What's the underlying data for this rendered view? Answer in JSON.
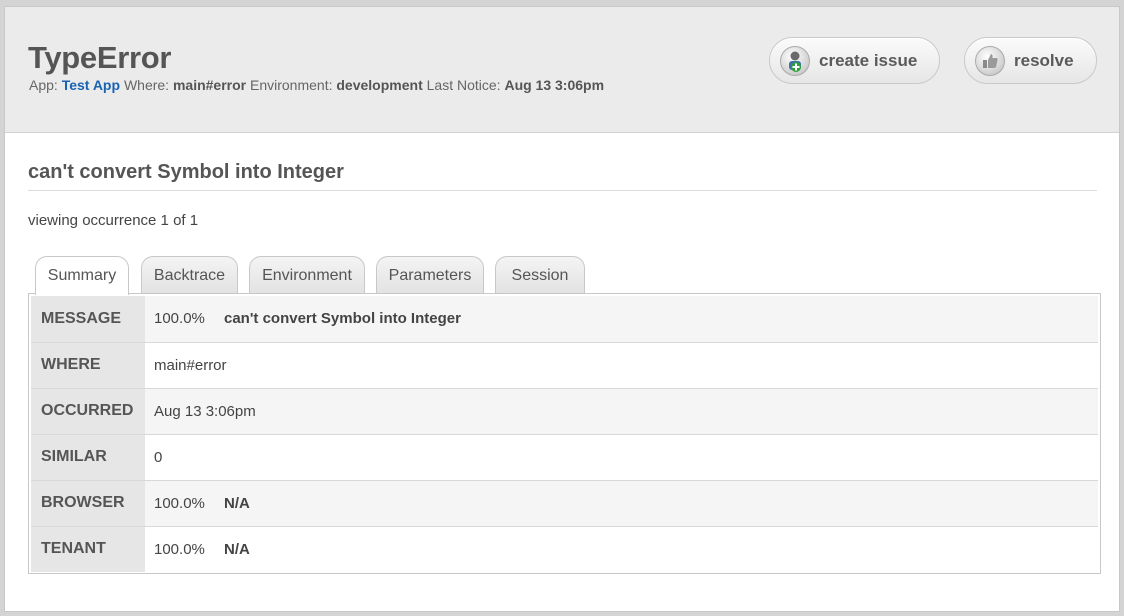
{
  "header": {
    "title": "TypeError",
    "app_label": "App:",
    "app_value": "Test App",
    "where_label": "Where:",
    "where_value": "main#error",
    "env_label": "Environment:",
    "env_value": "development",
    "last_notice_label": "Last Notice:",
    "last_notice_value": "Aug 13 3:06pm",
    "create_issue_label": "create issue",
    "resolve_label": "resolve"
  },
  "main": {
    "error_message": "can't convert Symbol into Integer",
    "occurrence_text": "viewing occurrence 1 of 1",
    "tabs": [
      {
        "label": "Summary",
        "active": true
      },
      {
        "label": "Backtrace",
        "active": false
      },
      {
        "label": "Environment",
        "active": false
      },
      {
        "label": "Parameters",
        "active": false
      },
      {
        "label": "Session",
        "active": false
      }
    ],
    "rows": [
      {
        "key": "MESSAGE",
        "pct": "100.0%",
        "value": "can't convert Symbol into Integer"
      },
      {
        "key": "WHERE",
        "value": "main#error"
      },
      {
        "key": "OCCURRED",
        "value": "Aug 13 3:06pm"
      },
      {
        "key": "SIMILAR",
        "value": "0"
      },
      {
        "key": "BROWSER",
        "pct": "100.0%",
        "value": "N/A"
      },
      {
        "key": "TENANT",
        "pct": "100.0%",
        "value": "N/A"
      }
    ]
  },
  "icons": {
    "create_issue": "person-add-icon",
    "resolve": "thumbs-up-icon"
  },
  "colors": {
    "link": "#1a63b3",
    "header_bg": "#ebebeb"
  }
}
